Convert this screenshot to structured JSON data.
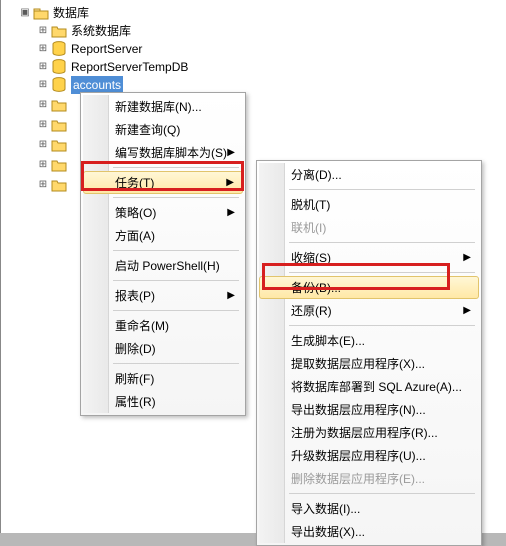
{
  "tree": {
    "root": "数据库",
    "child_sysdb": "系统数据库",
    "child_rs": "ReportServer",
    "child_rst": "ReportServerTempDB",
    "child_sel": "accounts"
  },
  "menu1": {
    "new_db": "新建数据库(N)...",
    "new_query": "新建查询(Q)",
    "script_as": "编写数据库脚本为(S)",
    "tasks": "任务(T)",
    "policies": "策略(O)",
    "facets": "方面(A)",
    "powershell": "启动 PowerShell(H)",
    "reports": "报表(P)",
    "rename": "重命名(M)",
    "delete": "删除(D)",
    "refresh": "刷新(F)",
    "properties": "属性(R)"
  },
  "menu2": {
    "detach": "分离(D)...",
    "offline": "脱机(T)",
    "online": "联机(I)",
    "shrink": "收缩(S)",
    "backup": "备份(B)...",
    "restore": "还原(R)",
    "gen_scripts": "生成脚本(E)...",
    "extract_dtier": "提取数据层应用程序(X)...",
    "deploy_azure": "将数据库部署到 SQL Azure(A)...",
    "export_dtier": "导出数据层应用程序(N)...",
    "register_dtier": "注册为数据层应用程序(R)...",
    "upgrade_dtier": "升级数据层应用程序(U)...",
    "delete_dtier": "删除数据层应用程序(E)...",
    "import_data": "导入数据(I)...",
    "export_data": "导出数据(X)..."
  }
}
